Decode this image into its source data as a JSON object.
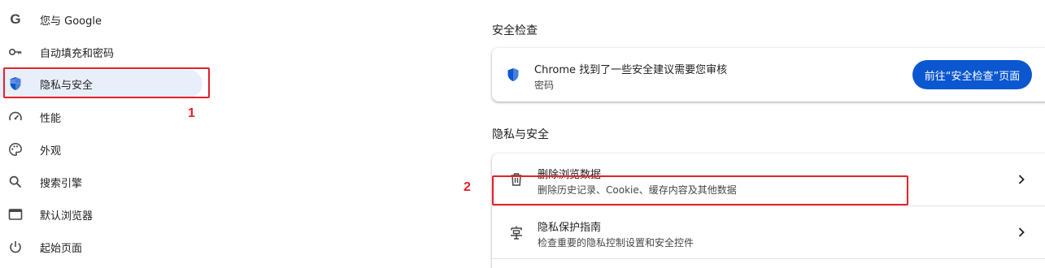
{
  "sidebar": {
    "items": [
      {
        "label": "您与 Google",
        "icon": "google-g-icon"
      },
      {
        "label": "自动填充和密码",
        "icon": "key-icon"
      },
      {
        "label": "隐私与安全",
        "icon": "shield-icon",
        "active": true
      },
      {
        "label": "性能",
        "icon": "speedometer-icon"
      },
      {
        "label": "外观",
        "icon": "palette-icon"
      },
      {
        "label": "搜索引擎",
        "icon": "search-icon"
      },
      {
        "label": "默认浏览器",
        "icon": "browser-window-icon"
      },
      {
        "label": "起始页面",
        "icon": "power-icon"
      }
    ]
  },
  "safety_check": {
    "section_title": "安全检查",
    "card_title": "Chrome 找到了一些安全建议需要您审核",
    "card_subtitle": "密码",
    "button_label": "前往“安全检查”页面"
  },
  "privacy": {
    "section_title": "隐私与安全",
    "rows": [
      {
        "title": "删除浏览数据",
        "subtitle": "删除历史记录、Cookie、缓存内容及其他数据",
        "icon": "trash-icon"
      },
      {
        "title": "隐私保护指南",
        "subtitle": "检查重要的隐私控制设置和安全控件",
        "icon": "privacy-guide-icon"
      }
    ]
  },
  "annotations": {
    "label_1": "1",
    "label_2": "2"
  },
  "colors": {
    "accent": "#0b57d0",
    "active_bg": "#e8effa",
    "annotation_red": "#e2212c"
  }
}
